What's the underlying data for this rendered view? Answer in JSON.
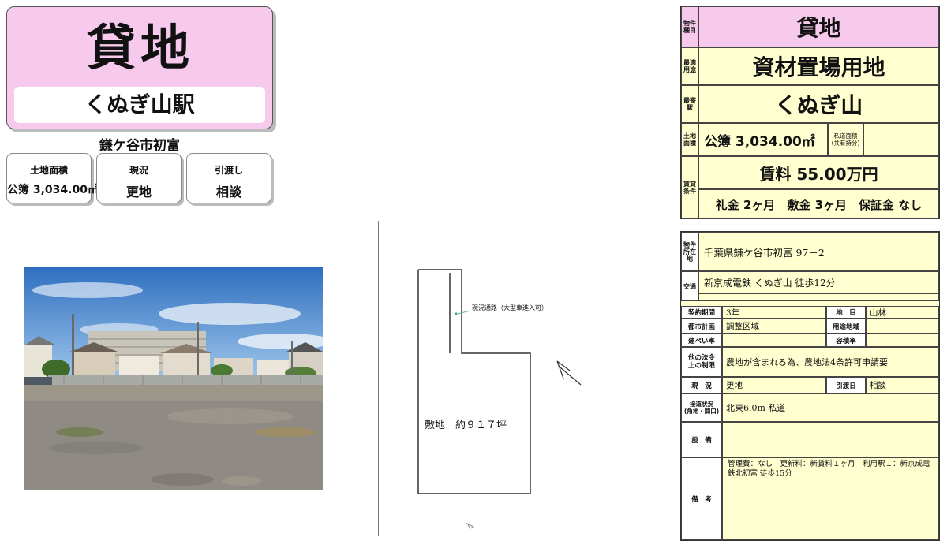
{
  "card": {
    "title": "貸地",
    "station": "くぬぎ山駅",
    "address": "鎌ケ谷市初富",
    "info": [
      {
        "label": "土地面積",
        "value": "公簿 3,034.00㎡"
      },
      {
        "label": "現況",
        "value": "更地"
      },
      {
        "label": "引渡し",
        "value": "相談"
      }
    ]
  },
  "map": {
    "road_note": "現況通路（大型車進入可）",
    "lot_label": "敷地　約９１７坪"
  },
  "summary": {
    "labels": {
      "type": "物件種目",
      "use": "最適用途",
      "station": "最寄駅",
      "area": "土地面積",
      "terms": "賃貸条件"
    },
    "type": "貸地",
    "use": "資材置場用地",
    "station": "くぬぎ山",
    "area": "公簿 3,034.00㎡",
    "private_road_label": "私道面積\n(共有持分)",
    "rent": "賃料 55.00万円",
    "terms_line": "礼金 2ヶ月　敷金 3ヶ月　保証金 なし"
  },
  "details": {
    "location_label": "物件所在地",
    "location": "千葉県鎌ケ谷市初富 97－2",
    "transport_label": "交通",
    "transport": "新京成電鉄 くぬぎ山 徒歩12分",
    "contract_label": "契約期間",
    "contract": "3年",
    "land_cat_label": "地　目",
    "land_cat": "山林",
    "city_plan_label": "都市計画",
    "city_plan": "調整区域",
    "zoning_label": "用途地域",
    "zoning": "",
    "bcr_label": "建ぺい率",
    "bcr": "",
    "far_label": "容積率",
    "far": "",
    "legal_label": "他の法令上の制限",
    "legal": "農地が含まれる為、農地法4条許可申請要",
    "status_label": "現　況",
    "status": "更地",
    "handover_label": "引渡日",
    "handover": "相談",
    "road_label": "接道状況\n(角地・間口)",
    "road": "北東6.0m 私道",
    "facility_label": "設　備",
    "facility": "",
    "remarks_label": "備　考",
    "remarks": "管理費：なし　更新料：新賃料１ヶ月　利用駅１：新京成電鉄北初富 徒歩15分"
  },
  "colors": {
    "pink": "#f7c9ec",
    "yellow": "#ffffcf"
  }
}
